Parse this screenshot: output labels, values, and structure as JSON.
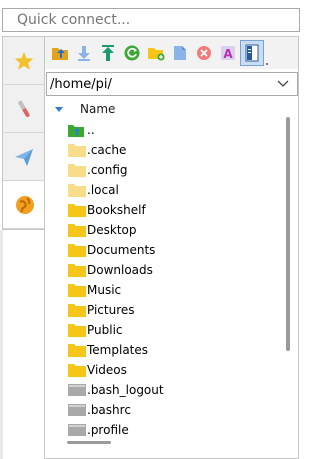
{
  "quick_connect": {
    "placeholder": "Quick connect..."
  },
  "side_tabs": [
    {
      "icon": "star-icon",
      "color": "#f2c12e"
    },
    {
      "icon": "tools-icon",
      "color": "#e06060"
    },
    {
      "icon": "send-icon",
      "color": "#5b9bd5"
    },
    {
      "icon": "globe-icon",
      "color": "#f0a020"
    }
  ],
  "toolbar": {
    "buttons": [
      {
        "icon": "parent-folder-icon"
      },
      {
        "icon": "download-icon"
      },
      {
        "icon": "upload-icon"
      },
      {
        "icon": "refresh-icon"
      },
      {
        "icon": "new-folder-icon"
      },
      {
        "icon": "new-file-icon"
      },
      {
        "icon": "delete-icon"
      },
      {
        "icon": "rename-icon"
      },
      {
        "icon": "view-toggle-icon"
      }
    ]
  },
  "path": {
    "value": "/home/pi/"
  },
  "list": {
    "header": "Name",
    "sort": "ascending",
    "items": [
      {
        "name": "..",
        "type": "parent"
      },
      {
        "name": ".cache",
        "type": "hidden-folder"
      },
      {
        "name": ".config",
        "type": "hidden-folder"
      },
      {
        "name": ".local",
        "type": "hidden-folder"
      },
      {
        "name": "Bookshelf",
        "type": "folder"
      },
      {
        "name": "Desktop",
        "type": "folder"
      },
      {
        "name": "Documents",
        "type": "folder"
      },
      {
        "name": "Downloads",
        "type": "folder"
      },
      {
        "name": "Music",
        "type": "folder"
      },
      {
        "name": "Pictures",
        "type": "folder"
      },
      {
        "name": "Public",
        "type": "folder"
      },
      {
        "name": "Templates",
        "type": "folder"
      },
      {
        "name": "Videos",
        "type": "folder"
      },
      {
        "name": ".bash_logout",
        "type": "file"
      },
      {
        "name": ".bashrc",
        "type": "file"
      },
      {
        "name": ".profile",
        "type": "file"
      }
    ]
  },
  "colors": {
    "folder": "#f5c518",
    "hidden_folder": "#f7dc8a",
    "accent": "#2f7fd0",
    "file": "#a9a9a9"
  }
}
